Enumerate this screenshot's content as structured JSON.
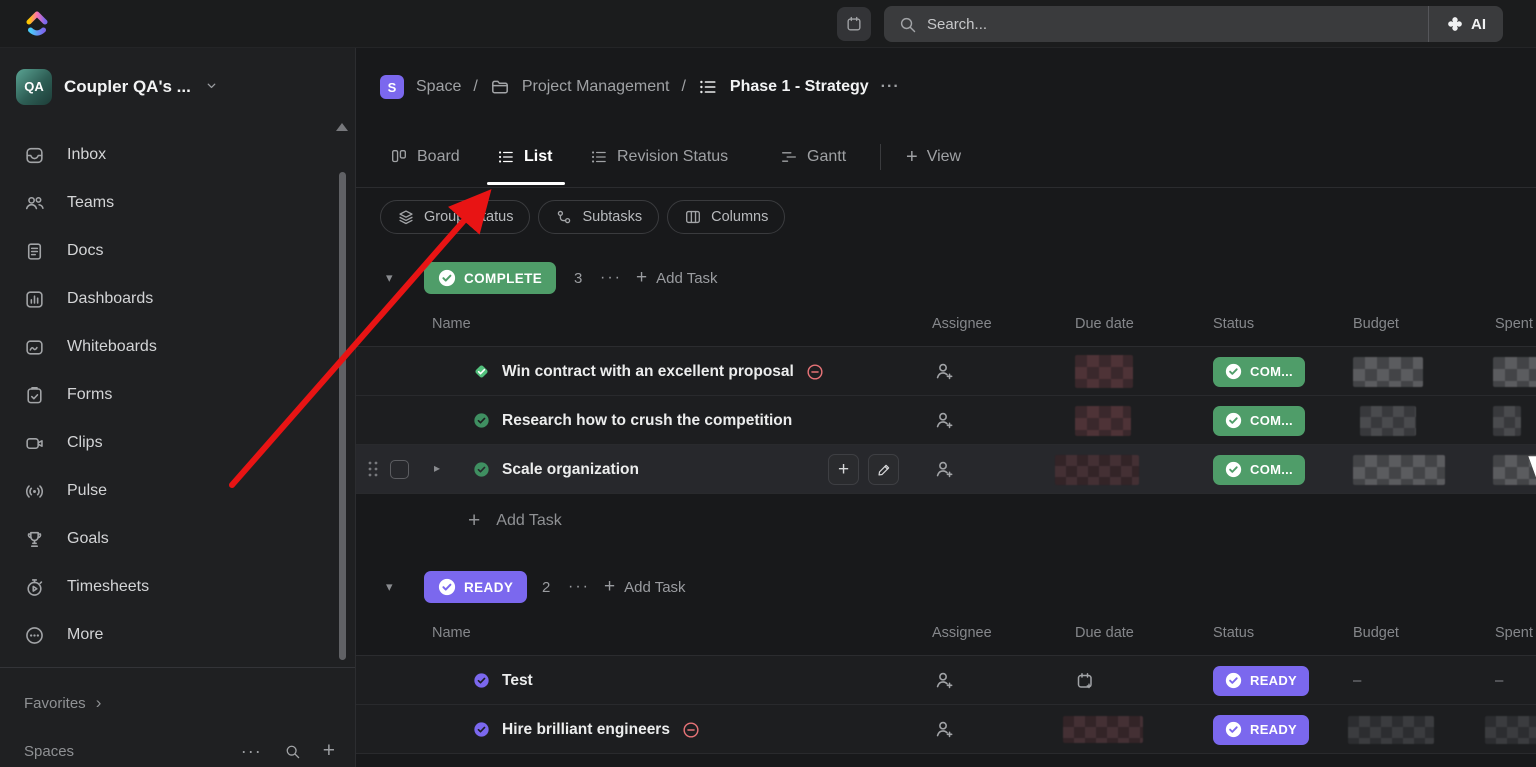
{
  "topbar": {
    "search_placeholder": "Search...",
    "ai_label": "AI"
  },
  "workspace": {
    "name": "Coupler QA's ...",
    "initials": "QA"
  },
  "sidebar": {
    "items": [
      {
        "label": "Inbox"
      },
      {
        "label": "Teams"
      },
      {
        "label": "Docs"
      },
      {
        "label": "Dashboards"
      },
      {
        "label": "Whiteboards"
      },
      {
        "label": "Forms"
      },
      {
        "label": "Clips"
      },
      {
        "label": "Pulse"
      },
      {
        "label": "Goals"
      },
      {
        "label": "Timesheets"
      },
      {
        "label": "More"
      }
    ],
    "favorites_label": "Favorites",
    "spaces_label": "Spaces"
  },
  "breadcrumb": {
    "space_initial": "S",
    "space": "Space",
    "project": "Project Management",
    "list": "Phase 1 - Strategy"
  },
  "tabs": {
    "board": "Board",
    "list": "List",
    "revision": "Revision Status",
    "gantt": "Gantt",
    "add_view": "View"
  },
  "toolbar": {
    "group_by": "Group: Status",
    "subtasks": "Subtasks",
    "columns": "Columns"
  },
  "table": {
    "columns": [
      "Name",
      "Assignee",
      "Due date",
      "Status",
      "Budget",
      "Spent"
    ]
  },
  "groups": [
    {
      "label": "COMPLETE",
      "count": "3",
      "status_short": "COM...",
      "add_task": "Add Task",
      "tasks": [
        {
          "name": "Win contract with an excellent proposal",
          "blocked": true
        },
        {
          "name": "Research how to crush the competition",
          "blocked": false
        },
        {
          "name": "Scale organization",
          "blocked": false
        }
      ]
    },
    {
      "label": "READY",
      "count": "2",
      "status_short": "READY",
      "add_task": "Add Task",
      "tasks": [
        {
          "name": "Test",
          "blocked": false,
          "budget": "–",
          "spent": "–"
        },
        {
          "name": "Hire brilliant engineers",
          "blocked": true
        }
      ]
    }
  ],
  "glyphs": {
    "ellipsis": "···",
    "plus": "+",
    "caret_down": "▾",
    "caret_right": "▸",
    "chevron_down": "⌄",
    "favorites_chevron": "›",
    "slash": "/",
    "dash": "–"
  },
  "colors": {
    "complete_green": "#4f9d69",
    "ready_purple": "#7b68ee",
    "bright_green_diamond": "#52c07c",
    "muted_green_circle": "#3f8f61",
    "blocked_red": "#e57276",
    "arrow_red": "#e81414",
    "space_badge_purple": "#7b68ee"
  }
}
